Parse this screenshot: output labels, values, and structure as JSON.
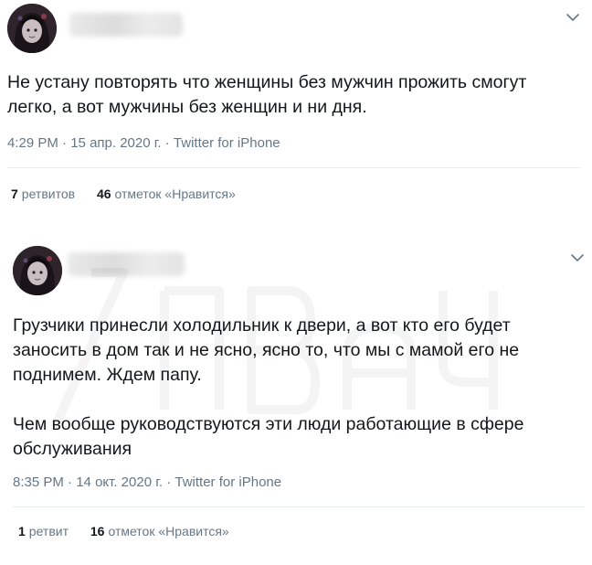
{
  "tweets": [
    {
      "text": "Не устану повторять что женщины без мужчин прожить смогут\nлегко, а вот мужчины без женщин и ни дня.",
      "time": "4:29 PM",
      "date": "15 апр. 2020 г.",
      "source": "Twitter for iPhone",
      "retweets_count": "7",
      "retweets_label": "ретвитов",
      "likes_count": "46",
      "likes_label": "отметок «Нравится»"
    },
    {
      "text": "Грузчики принесли холодильник к двери, а вот кто его будет\nзаносить в дом так и не ясно, ясно то, что мы с мамой его не\nподнимем. Ждем папу.\n\nЧем вообще руководствуются эти люди работающие в сфере\nобслуживания",
      "time": "8:35 PM",
      "date": "14 окт. 2020 г.",
      "source": "Twitter for iPhone",
      "retweets_count": "1",
      "retweets_label": "ретвит",
      "likes_count": "16",
      "likes_label": "отметок «Нравится»"
    }
  ],
  "meta_separator": " · ",
  "icons": {
    "menu": "chevron-down-icon",
    "avatar": "avatar-icon"
  },
  "colors": {
    "text": "#14171a",
    "secondary": "#657786",
    "divider": "#e6ecf0"
  }
}
